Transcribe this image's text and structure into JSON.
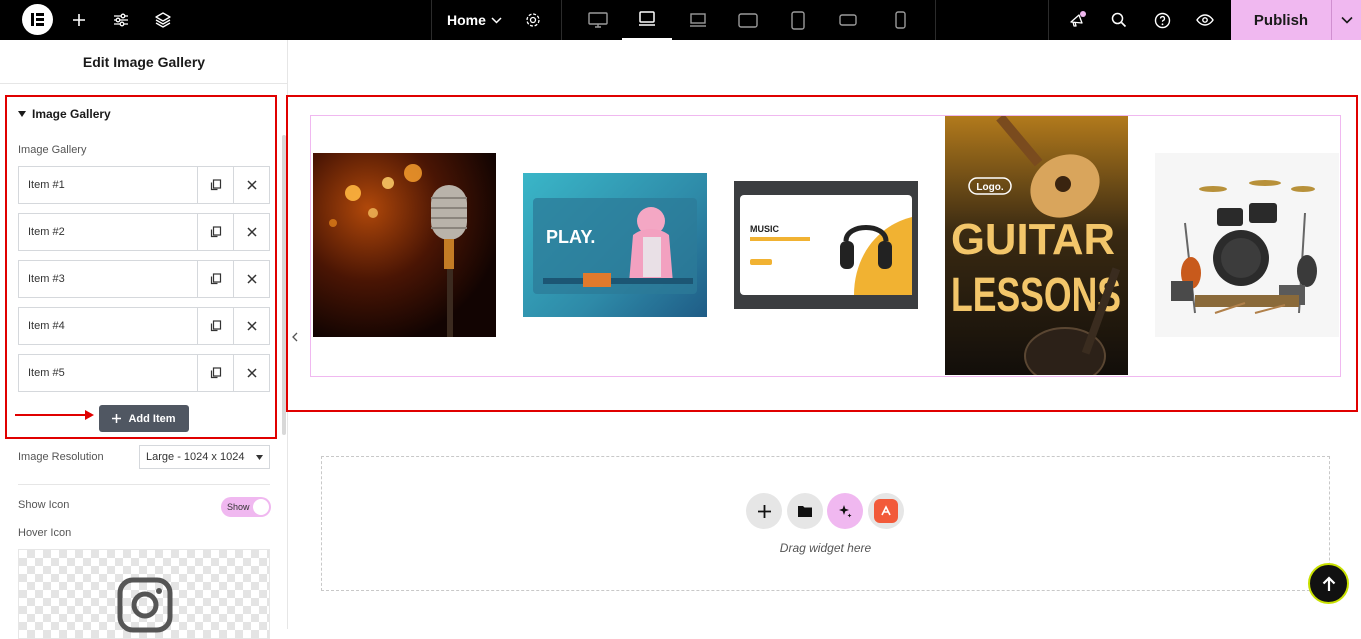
{
  "topbar": {
    "page_name": "Home",
    "publish_label": "Publish",
    "icons": [
      "elementor-logo-icon",
      "add-icon",
      "settings-sliders-icon",
      "layers-icon",
      "chevron-down-icon",
      "gear-icon",
      "desktop-icon",
      "laptop-icon",
      "tablet-landscape-icon",
      "tablet-icon",
      "mobile-landscape-icon",
      "mobile-icon",
      "notifications-icon",
      "search-icon",
      "help-icon",
      "preview-eye-icon"
    ]
  },
  "panel": {
    "title": "Edit Image Gallery",
    "section_title": "Image Gallery",
    "field_label": "Image Gallery",
    "items": [
      {
        "label": "Item #1"
      },
      {
        "label": "Item #2"
      },
      {
        "label": "Item #3"
      },
      {
        "label": "Item #4"
      },
      {
        "label": "Item #5"
      }
    ],
    "add_item_label": "Add Item",
    "resolution_label": "Image Resolution",
    "resolution_value": "Large - 1024 x 1024",
    "show_icon_label": "Show Icon",
    "show_icon_toggle": "Show",
    "hover_icon_label": "Hover Icon"
  },
  "canvas": {
    "gallery": [
      {
        "name": "microphone-image"
      },
      {
        "name": "music-app-play-image",
        "text": "PLAY."
      },
      {
        "name": "music-headphones-image",
        "text": "MUSIC"
      },
      {
        "name": "guitar-lessons-poster-image",
        "logo": "Logo.",
        "line1": "GUITAR",
        "line2": "LESSONS"
      },
      {
        "name": "instruments-image"
      }
    ],
    "drag_text": "Drag widget here"
  },
  "colors": {
    "accent_pink": "#f0b8f0",
    "highlight_red": "#e00000",
    "topbar_bg": "#000000"
  }
}
